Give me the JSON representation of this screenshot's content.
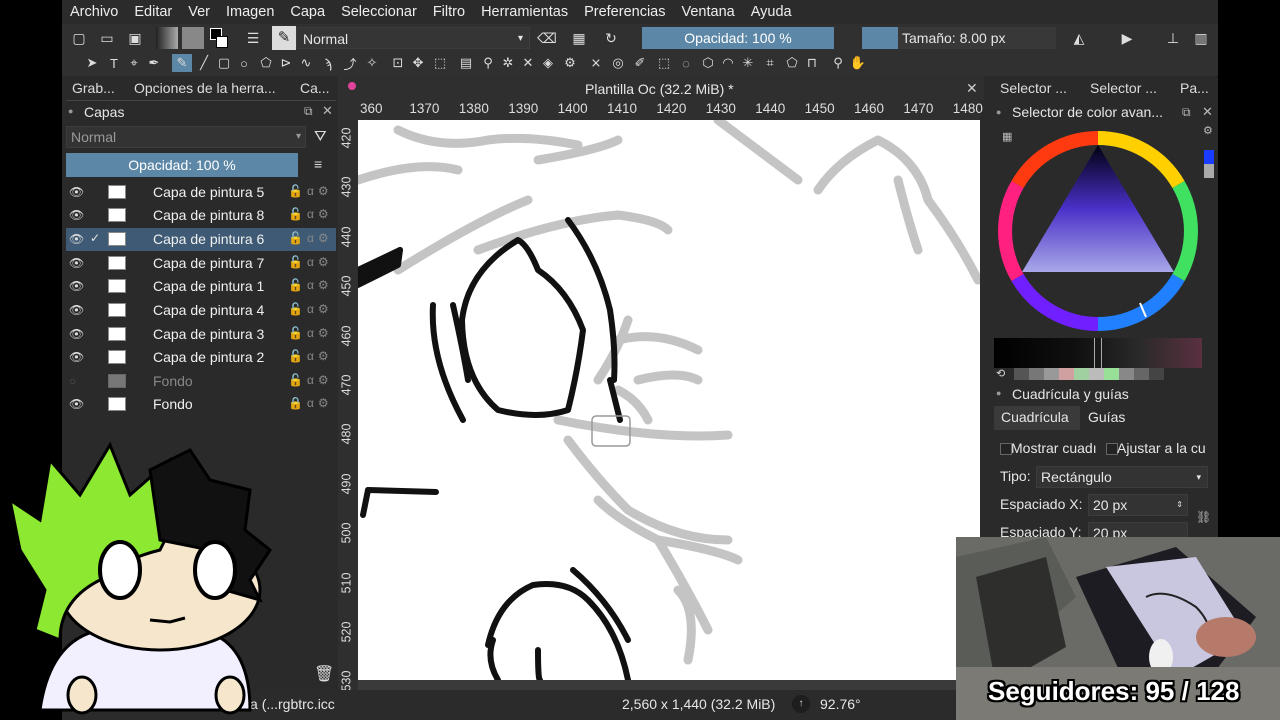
{
  "menu": [
    "Archivo",
    "Editar",
    "Ver",
    "Imagen",
    "Capa",
    "Seleccionar",
    "Filtro",
    "Herramientas",
    "Preferencias",
    "Ventana",
    "Ayuda"
  ],
  "toolbar": {
    "blend_mode": "Normal",
    "opacity_label": "Opacidad: 100 %",
    "size_label": "Tamaño: 8.00 px"
  },
  "left_tabs": [
    "Grab...",
    "Opciones de la herra...",
    "Ca..."
  ],
  "layers_panel": {
    "title": "Capas",
    "blend_mode": "Normal",
    "opacity_label": "Opacidad:  100 %",
    "layers": [
      {
        "name": "Capa de pintura 5",
        "visible": true,
        "selected": false
      },
      {
        "name": "Capa de pintura 8",
        "visible": true,
        "selected": false
      },
      {
        "name": "Capa de pintura 6",
        "visible": true,
        "selected": true
      },
      {
        "name": "Capa de pintura 7",
        "visible": true,
        "selected": false
      },
      {
        "name": "Capa de pintura 1",
        "visible": true,
        "selected": false
      },
      {
        "name": "Capa de pintura 4",
        "visible": true,
        "selected": false
      },
      {
        "name": "Capa de pintura 3",
        "visible": true,
        "selected": false
      },
      {
        "name": "Capa de pintura 2",
        "visible": true,
        "selected": false
      },
      {
        "name": "Fondo",
        "visible": false,
        "selected": false
      },
      {
        "name": "Fondo",
        "visible": true,
        "selected": false
      }
    ]
  },
  "document": {
    "tab_title": "Plantilla Oc (32.2 MiB) *",
    "ruler_h": [
      "360",
      "1370",
      "1380",
      "1390",
      "1400",
      "1410",
      "1420",
      "1430",
      "1440",
      "1450",
      "1460",
      "1470",
      "1480"
    ],
    "ruler_v": [
      "420",
      "430",
      "440",
      "450",
      "460",
      "470",
      "480",
      "490",
      "500",
      "510",
      "520",
      "530"
    ]
  },
  "right_tabs": [
    "Selector ...",
    "Selector ...",
    "Pa..."
  ],
  "color_panel": {
    "title": "Selector de color avan..."
  },
  "grid_panel": {
    "title": "Cuadrícula y guías",
    "tabs": [
      "Cuadrícula",
      "Guías"
    ],
    "show_grid": "Mostrar cuadı",
    "snap_grid": "Ajustar a la cu",
    "type_label": "Tipo:",
    "type_value": "Rectángulo",
    "spacing_x_label": "Espaciado X:",
    "spacing_x_value": "20 px",
    "spacing_y_label": "Espaciado Y:",
    "spacing_y_value": "20 px"
  },
  "status": {
    "profile": "B/alfa (...rgbtrc.icc",
    "dimensions": "2,560 x 1,440 (32.2 MiB)",
    "zoom": "92.76°"
  },
  "overlay": {
    "followers": "Seguidores: 95 / 128"
  }
}
